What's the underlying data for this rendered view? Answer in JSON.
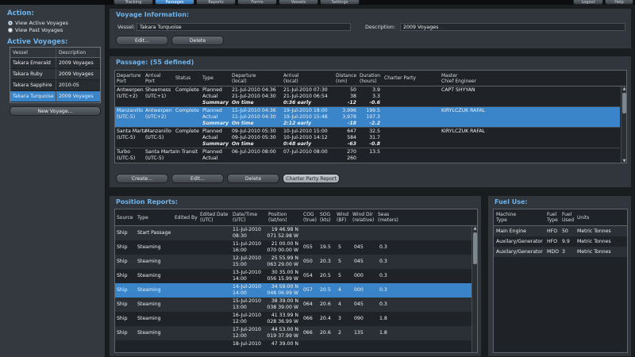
{
  "nav": {
    "tabs": [
      {
        "label": "Tracking"
      },
      {
        "label": "Passages"
      },
      {
        "label": "Reports"
      },
      {
        "label": "Forms"
      },
      {
        "label": "Vessels"
      },
      {
        "label": "Settings"
      },
      {
        "label": "Logout"
      },
      {
        "label": "Help"
      }
    ]
  },
  "sidebar": {
    "action_title": "Action:",
    "view_active": "View Active Voyages",
    "view_past": "View Past Voyages",
    "active_title": "Active Voyages:",
    "table": {
      "headers": [
        "Vessel",
        "Description"
      ],
      "rows": [
        [
          "Takara Emerald",
          "2009 Voyages"
        ],
        [
          "Takara Ruby",
          "2009 Voyages"
        ],
        [
          "Takara Sapphire",
          "2010-05"
        ],
        [
          "Takara Turquoise",
          "2009 Voyages"
        ]
      ]
    },
    "new_voyage": "New Voyage..."
  },
  "voyage_info": {
    "title": "Voyage Information:",
    "vessel_label": "Vessel:",
    "vessel_value": "Takara Turquoise",
    "desc_label": "Description:",
    "desc_value": "2009 Voyages",
    "edit": "Edit...",
    "delete": "Delete"
  },
  "passage": {
    "title": "Passage: (55 defined)",
    "headers": {
      "dep": [
        "Departure",
        "Port"
      ],
      "arr": [
        "Arrival",
        "Port"
      ],
      "status": "Status",
      "type": "Type",
      "deptime": [
        "Departure",
        "(local)"
      ],
      "arrtime": [
        "Arrival",
        "(local)"
      ],
      "dist": [
        "Distance",
        "(nm)"
      ],
      "dur": [
        "Duration",
        "(hours)"
      ],
      "charter": "Charter Party",
      "master": [
        "Master",
        "Chief Engineer"
      ]
    },
    "groups": [
      {
        "dep": [
          "Antwerpen",
          "(UTC+2)"
        ],
        "arr": [
          "Sheerness",
          "(UTC+1)"
        ],
        "status": "Complete",
        "rows": [
          {
            "type": "Planned",
            "deptime": "21-Jul-2010 04:36",
            "arrtime": "21-Jul-2010 07:30",
            "dist": "50",
            "dur": "3.9"
          },
          {
            "type": "Actual",
            "deptime": "21-Jul-2010 04:30",
            "arrtime": "21-Jul-2010 06:54",
            "dist": "38",
            "dur": "3.3"
          },
          {
            "type": "Summary",
            "deptime": "On time",
            "arrtime": "0:36 early",
            "dist": "-12",
            "dur": "-0.6"
          }
        ],
        "master": "CAPT SHYYAN"
      },
      {
        "dep": [
          "Manzanillo",
          "(UTC-5)"
        ],
        "arr": [
          "Antwerpen",
          "(UTC+2)"
        ],
        "status": "Complete",
        "rows": [
          {
            "type": "Planned",
            "deptime": "11-Jul-2010 04:36",
            "arrtime": "19-Jul-2010 18:00",
            "dist": "3,996",
            "dur": "199.5"
          },
          {
            "type": "Actual",
            "deptime": "11-Jul-2010 04:30",
            "arrtime": "19-Jul-2010 15:48",
            "dist": "3,978",
            "dur": "197.3"
          },
          {
            "type": "Summary",
            "deptime": "On time",
            "arrtime": "2:12 early",
            "dist": "-18",
            "dur": "-2.2"
          }
        ],
        "master": "KIRYLCZUK RAFAL"
      },
      {
        "dep": [
          "Santa Marta",
          "(UTC-5)"
        ],
        "arr": [
          "Manzanillo",
          "(UTC-5)"
        ],
        "status": "Complete",
        "rows": [
          {
            "type": "Planned",
            "deptime": "09-Jul-2010 05:30",
            "arrtime": "10-Jul-2010 15:00",
            "dist": "647",
            "dur": "32.5"
          },
          {
            "type": "Actual",
            "deptime": "09-Jul-2010 05:30",
            "arrtime": "10-Jul-2010 14:12",
            "dist": "584",
            "dur": "31.7"
          },
          {
            "type": "Summary",
            "deptime": "On time",
            "arrtime": "0:48 early",
            "dist": "-63",
            "dur": "-0.8"
          }
        ],
        "master": "KIRYLCZUK RAFAL"
      },
      {
        "dep": [
          "Turbo",
          "(UTC-5)"
        ],
        "arr": [
          "Santa Marta",
          "(UTC-5)"
        ],
        "status": "In Transit",
        "rows": [
          {
            "type": "Planned",
            "deptime": "06-Jul-2010 08:00",
            "arrtime": "07-Jul-2010 08:00",
            "dist": "270",
            "dur": "13.5"
          },
          {
            "type": "Actual",
            "deptime": "",
            "arrtime": "",
            "dist": "260",
            "dur": ""
          }
        ],
        "master": ""
      }
    ],
    "buttons": {
      "create": "Create...",
      "edit": "Edit...",
      "delete": "Delete",
      "charter": "Charter Party Report"
    }
  },
  "position": {
    "title": "Position Reports:",
    "headers": {
      "source": "Source",
      "type": "Type",
      "edited_by": "Edited By",
      "edited_date": [
        "Edited Date",
        "(UTC)"
      ],
      "datetime": [
        "Date/Time",
        "(UTC)"
      ],
      "position": [
        "Position",
        "(lat/lon)"
      ],
      "cog": [
        "COG",
        "(true)"
      ],
      "sog": [
        "SOG",
        "(kts)"
      ],
      "wind": [
        "Wind",
        "(BF)"
      ],
      "winddir": [
        "Wind Dir",
        "(relative)"
      ],
      "seas": [
        "Seas",
        "(meters)"
      ]
    },
    "rows": [
      {
        "source": "Ship",
        "type": "Start Passage",
        "date": "11-Jul-2010",
        "time": "08:30",
        "lat": "19 46.98 N",
        "lon": "071 52.98 W",
        "cog": "",
        "sog": "",
        "wind": "",
        "winddir": "",
        "seas": ""
      },
      {
        "source": "Ship",
        "type": "Steaming",
        "date": "11-Jul-2010",
        "time": "16:00",
        "lat": "21 00.00 N",
        "lon": "070 00.00 W",
        "cog": "055",
        "sog": "19.5",
        "wind": "5",
        "winddir": "045",
        "seas": "0.3"
      },
      {
        "source": "Ship",
        "type": "Steaming",
        "date": "12-Jul-2010",
        "time": "15:00",
        "lat": "25 55.99 N",
        "lon": "063 29.00 W",
        "cog": "050",
        "sog": "20.3",
        "wind": "5",
        "winddir": "045",
        "seas": "0.3"
      },
      {
        "source": "Ship",
        "type": "Steaming",
        "date": "13-Jul-2010",
        "time": "14:00",
        "lat": "30 35.00 N",
        "lon": "056 15.99 W",
        "cog": "054",
        "sog": "20.5",
        "wind": "5",
        "winddir": "000",
        "seas": "0.3"
      },
      {
        "source": "Ship",
        "type": "Steaming",
        "date": "14-Jul-2010",
        "time": "14:00",
        "lat": "34 59.00 N",
        "lon": "048 06.99 W",
        "cog": "057",
        "sog": "20.5",
        "wind": "4",
        "winddir": "000",
        "seas": "0.3"
      },
      {
        "source": "Ship",
        "type": "Steaming",
        "date": "15-Jul-2010",
        "time": "13:00",
        "lat": "38 39.00 N",
        "lon": "038 39.00 W",
        "cog": "064",
        "sog": "20.6",
        "wind": "4",
        "winddir": "045",
        "seas": "0.3"
      },
      {
        "source": "Ship",
        "type": "Steaming",
        "date": "16-Jul-2010",
        "time": "12:00",
        "lat": "41 33.99 N",
        "lon": "028 36.99 W",
        "cog": "066",
        "sog": "20.4",
        "wind": "3",
        "winddir": "090",
        "seas": "1.8"
      },
      {
        "source": "Ship",
        "type": "Steaming",
        "date": "17-Jul-2010",
        "time": "12:00",
        "lat": "44 53.00 N",
        "lon": "019 37.99 W",
        "cog": "066",
        "sog": "20.6",
        "wind": "2",
        "winddir": "135",
        "seas": "1.8"
      },
      {
        "source": "Ship",
        "type": "Steaming",
        "date": "18-Jul-2010",
        "time": "",
        "lat": "47 39.00 N",
        "lon": "",
        "cog": "",
        "sog": "",
        "wind": "",
        "winddir": "",
        "seas": ""
      }
    ]
  },
  "fuel": {
    "title": "Fuel Use:",
    "headers": {
      "machine": [
        "Machine",
        "Type"
      ],
      "ftype": [
        "Fuel",
        "Type"
      ],
      "used": [
        "Fuel",
        "Used"
      ],
      "units": "Units"
    },
    "rows": [
      {
        "machine": "Main Engine",
        "ftype": "HFO",
        "used": "50",
        "units": "Metric Tonnes"
      },
      {
        "machine": "Auxilary/Generator",
        "ftype": "HFO",
        "used": "9.9",
        "units": "Metric Tonnes"
      },
      {
        "machine": "Auxilary/Generator",
        "ftype": "MDO",
        "used": "3",
        "units": "Metric Tonnes"
      }
    ]
  }
}
